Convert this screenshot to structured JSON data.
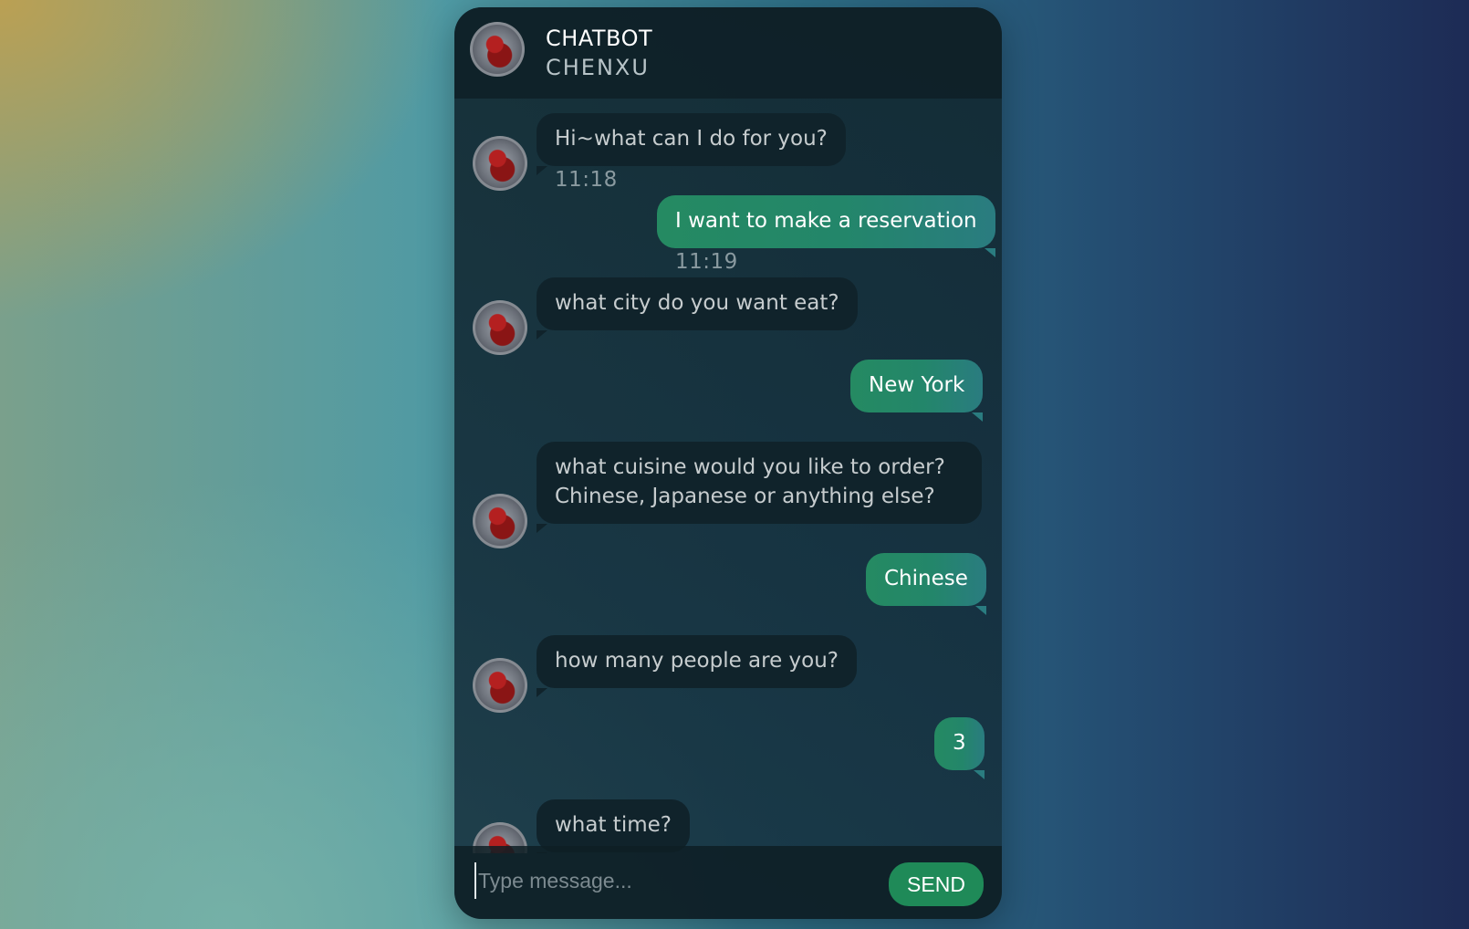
{
  "header": {
    "title": "CHATBOT",
    "subtitle": "CHENXU",
    "avatar_icon": "iron-man-avatar-icon"
  },
  "messages": [
    {
      "sender": "bot",
      "text": "Hi~what can I do for you?",
      "time": "11:18"
    },
    {
      "sender": "user",
      "text": "I want to make a reservation",
      "time": "11:19"
    },
    {
      "sender": "bot",
      "text": "what city do you want eat?"
    },
    {
      "sender": "user",
      "text": "New York"
    },
    {
      "sender": "bot",
      "text": "what cuisine would you like to order? Chinese, Japanese or anything else?"
    },
    {
      "sender": "user",
      "text": "Chinese"
    },
    {
      "sender": "bot",
      "text": "how many people are you?"
    },
    {
      "sender": "user",
      "text": "3"
    },
    {
      "sender": "bot",
      "text": "what time?"
    }
  ],
  "input": {
    "placeholder": "Type message...",
    "value": ""
  },
  "send_label": "SEND",
  "colors": {
    "user_bubble": "#258a62",
    "bot_bubble": "#10232b",
    "send_button": "#1f8a58"
  }
}
